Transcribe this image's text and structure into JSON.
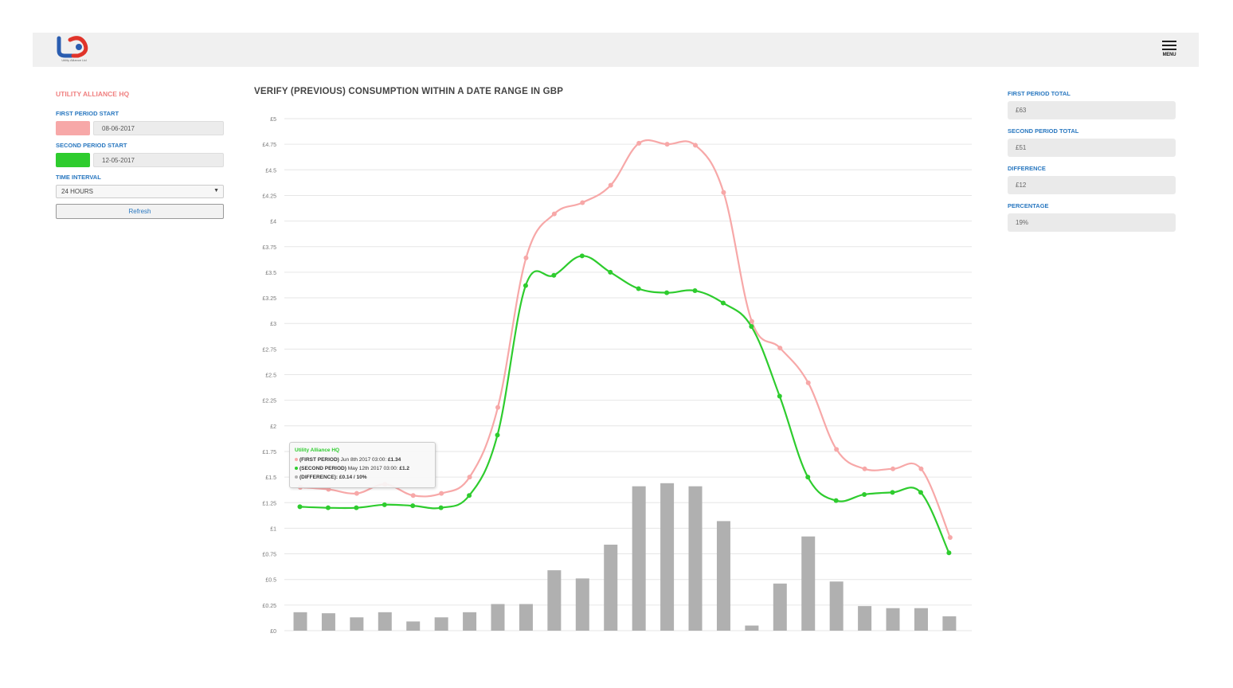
{
  "header": {
    "logo_text": "UA",
    "logo_tagline": "Utility Alliance Ltd",
    "menu_label": "MENU"
  },
  "sidebar": {
    "site_title": "UTILITY ALLIANCE HQ",
    "first_period_label": "FIRST PERIOD START",
    "first_period_value": "08-06-2017",
    "first_period_color": "#f7a8a8",
    "second_period_label": "SECOND PERIOD START",
    "second_period_value": "12-05-2017",
    "second_period_color": "#2ecc2e",
    "interval_label": "TIME INTERVAL",
    "interval_value": "24 HOURS",
    "refresh_label": "Refresh"
  },
  "summary": {
    "first_total_label": "FIRST PERIOD TOTAL",
    "first_total_value": "£63",
    "second_total_label": "SECOND PERIOD TOTAL",
    "second_total_value": "£51",
    "difference_label": "DIFFERENCE",
    "difference_value": "£12",
    "percentage_label": "PERCENTAGE",
    "percentage_value": "19%"
  },
  "tooltip": {
    "title": "Utility Alliance HQ",
    "line1_label": "(FIRST PERIOD)",
    "line1_date": "Jun 8th 2017 03:00:",
    "line1_value": "£1.34",
    "line2_label": "(SECOND PERIOD)",
    "line2_date": "May 12th 2017 03:00:",
    "line2_value": "£1.2",
    "line3_label": "(DIFFERENCE):",
    "line3_value": "£0.14 / 10%"
  },
  "chart_data": {
    "type": "line",
    "title": "VERIFY (PREVIOUS) CONSUMPTION WITHIN A DATE RANGE IN GBP",
    "y_ticks": [
      "£0",
      "£0.25",
      "£0.5",
      "£0.75",
      "£1",
      "£1.25",
      "£1.5",
      "£1.75",
      "£2",
      "£2.25",
      "£2.5",
      "£2.75",
      "£3",
      "£3.25",
      "£3.5",
      "£3.75",
      "£4",
      "£4.25",
      "£4.5",
      "£4.75",
      "£5"
    ],
    "ylim": [
      0,
      5
    ],
    "grid": true,
    "series": [
      {
        "values": [
          1.4,
          1.38,
          1.34,
          1.43,
          1.32,
          1.34,
          1.5,
          2.18,
          3.64,
          4.07,
          4.18,
          4.35,
          4.76,
          4.75,
          4.74,
          4.28,
          3.02,
          2.76,
          2.42,
          1.77,
          1.58,
          1.58,
          1.58,
          0.91
        ],
        "color": "#f7a8a8"
      },
      {
        "values": [
          1.21,
          1.2,
          1.2,
          1.23,
          1.22,
          1.2,
          1.32,
          1.91,
          3.37,
          3.47,
          3.66,
          3.5,
          3.34,
          3.3,
          3.32,
          3.2,
          2.97,
          2.29,
          1.5,
          1.27,
          1.33,
          1.35,
          1.35,
          0.76
        ],
        "color": "#2ecc2e"
      }
    ],
    "bars": {
      "values": [
        0.18,
        0.17,
        0.13,
        0.18,
        0.09,
        0.13,
        0.18,
        0.26,
        0.26,
        0.59,
        0.51,
        0.84,
        1.41,
        1.44,
        1.41,
        1.07,
        0.05,
        0.46,
        0.92,
        0.48,
        0.24,
        0.22,
        0.22,
        0.14
      ],
      "color": "#b0b0b0"
    }
  }
}
